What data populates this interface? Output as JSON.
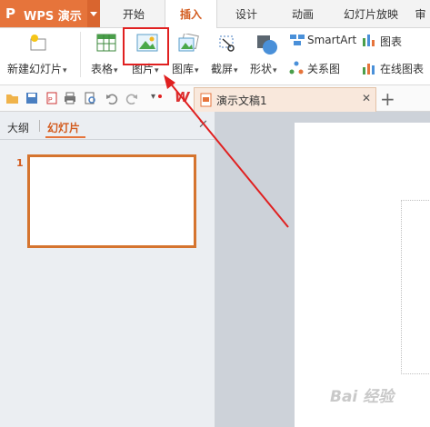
{
  "app": {
    "name": "WPS 演示"
  },
  "menu_tabs": [
    "开始",
    "插入",
    "设计",
    "动画",
    "幻灯片放映",
    "审"
  ],
  "active_tab": "插入",
  "ribbon": {
    "new_slide": "新建幻灯片",
    "table": "表格",
    "picture": "图片",
    "gallery": "图库",
    "screenshot": "截屏",
    "shapes": "形状",
    "relation": "关系图",
    "smartart": "SmartArt",
    "chart": "图表",
    "online_chart": "在线图表"
  },
  "document_tab": {
    "title": "演示文稿1"
  },
  "left_panel": {
    "tab_outline": "大纲",
    "tab_slides": "幻灯片",
    "slide_number": "1"
  },
  "watermark": "Bai 经验",
  "colors": {
    "accent": "#e6743b",
    "highlight": "#e02020",
    "active_tab_text": "#d35b1e"
  }
}
